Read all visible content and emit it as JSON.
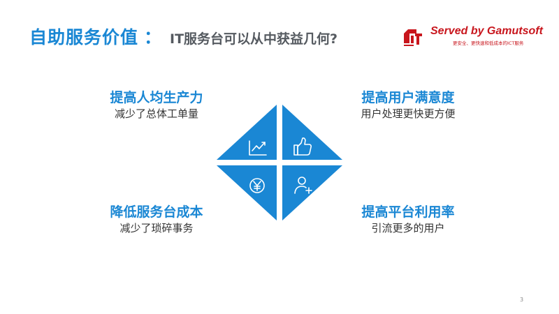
{
  "header": {
    "title": "自助服务价值",
    "separator": "：",
    "subtitle": "IT服务台可以从中获益几何?"
  },
  "logo": {
    "brand": "Served by Gamutsoft",
    "tagline": "更安全、更快速和低成本的ICT服务",
    "mark": "gamutsoft-logo-mark"
  },
  "benefits": {
    "top_left": {
      "title": "提高人均生产力",
      "desc": "减少了总体工单量",
      "icon": "trend-chart-icon"
    },
    "top_right": {
      "title": "提高用户满意度",
      "desc": "用户处理更快更方便",
      "icon": "thumbs-up-icon"
    },
    "bottom_left": {
      "title": "降低服务台成本",
      "desc": "减少了琐碎事务",
      "icon": "yuan-coin-icon"
    },
    "bottom_right": {
      "title": "提高平台利用率",
      "desc": "引流更多的用户",
      "icon": "add-user-icon"
    }
  },
  "colors": {
    "accent": "#1a87d4",
    "brand": "#c8161d",
    "text_dark": "#333333",
    "subtitle_gray": "#555a60"
  },
  "page_number": "3"
}
